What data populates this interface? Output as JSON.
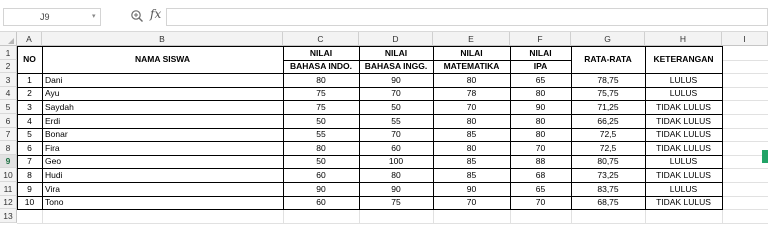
{
  "formula_bar": {
    "name_box": "J9",
    "fx_label": "fx",
    "formula_value": ""
  },
  "columns": [
    "A",
    "B",
    "C",
    "D",
    "E",
    "F",
    "G",
    "H",
    "I"
  ],
  "rows": [
    "1",
    "2",
    "3",
    "4",
    "5",
    "6",
    "7",
    "8",
    "9",
    "10",
    "11",
    "12",
    "13"
  ],
  "active_row": "9",
  "table": {
    "header_no": "NO",
    "header_name": "NAMA SISWA",
    "header_nilai": "NILAI",
    "subjects": [
      "BAHASA INDO.",
      "BAHASA INGG.",
      "MATEMATIKA",
      "IPA"
    ],
    "header_avg": "RATA-RATA",
    "header_desc": "KETERANGAN",
    "records": [
      {
        "no": "1",
        "name": "Dani",
        "indo": "80",
        "ingg": "90",
        "mtk": "80",
        "ipa": "65",
        "avg": "78,75",
        "desc": "LULUS"
      },
      {
        "no": "2",
        "name": "Ayu",
        "indo": "75",
        "ingg": "70",
        "mtk": "78",
        "ipa": "80",
        "avg": "75,75",
        "desc": "LULUS"
      },
      {
        "no": "3",
        "name": "Saydah",
        "indo": "75",
        "ingg": "50",
        "mtk": "70",
        "ipa": "90",
        "avg": "71,25",
        "desc": "TIDAK LULUS"
      },
      {
        "no": "4",
        "name": "Erdi",
        "indo": "50",
        "ingg": "55",
        "mtk": "80",
        "ipa": "80",
        "avg": "66,25",
        "desc": "TIDAK LULUS"
      },
      {
        "no": "5",
        "name": "Bonar",
        "indo": "55",
        "ingg": "70",
        "mtk": "85",
        "ipa": "80",
        "avg": "72,5",
        "desc": "TIDAK LULUS"
      },
      {
        "no": "6",
        "name": "Fira",
        "indo": "80",
        "ingg": "60",
        "mtk": "80",
        "ipa": "70",
        "avg": "72,5",
        "desc": "TIDAK LULUS"
      },
      {
        "no": "7",
        "name": "Geo",
        "indo": "50",
        "ingg": "100",
        "mtk": "85",
        "ipa": "88",
        "avg": "80,75",
        "desc": "LULUS"
      },
      {
        "no": "8",
        "name": "Hudi",
        "indo": "60",
        "ingg": "80",
        "mtk": "85",
        "ipa": "68",
        "avg": "73,25",
        "desc": "TIDAK LULUS"
      },
      {
        "no": "9",
        "name": "Vira",
        "indo": "90",
        "ingg": "90",
        "mtk": "90",
        "ipa": "65",
        "avg": "83,75",
        "desc": "LULUS"
      },
      {
        "no": "10",
        "name": "Tono",
        "indo": "60",
        "ingg": "75",
        "mtk": "70",
        "ipa": "70",
        "avg": "68,75",
        "desc": "TIDAK LULUS"
      }
    ]
  },
  "colors": {
    "accent": "#217346",
    "selection": "#21a366",
    "gridline": "#e1e1e1",
    "header_bg": "#f3f3f3"
  }
}
